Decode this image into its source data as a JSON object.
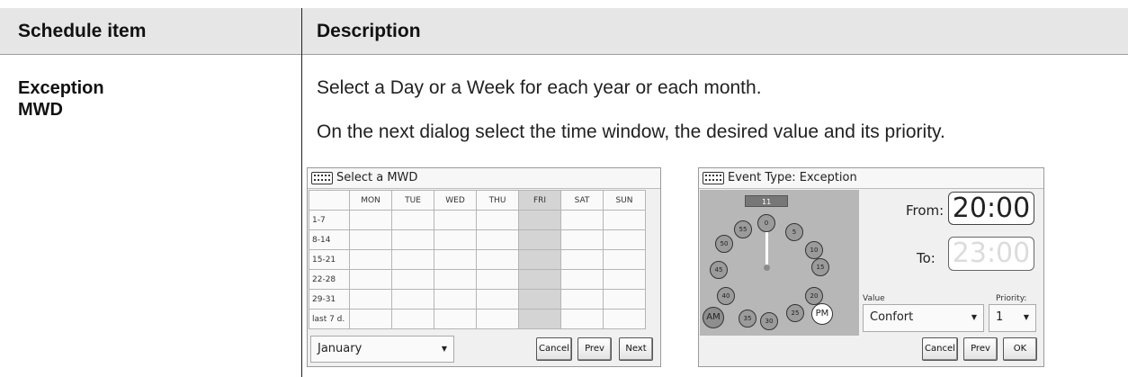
{
  "table": {
    "header_item": "Schedule item",
    "header_desc": "Description",
    "row_item_line1": "Exception",
    "row_item_line2": "MWD",
    "desc_line1": "Select a Day or a Week for each year or each month.",
    "desc_line2": "On the next dialog select the time window, the desired value and its priority."
  },
  "mwd_dialog": {
    "title": "Select a MWD",
    "days": [
      "MON",
      "TUE",
      "WED",
      "THU",
      "FRI",
      "SAT",
      "SUN"
    ],
    "rows": [
      "1-7",
      "8-14",
      "15-21",
      "22-28",
      "29-31",
      "last 7 d."
    ],
    "highlighted_day": "FRI",
    "month_value": "January",
    "cancel_label": "Cancel",
    "prev_label": "Prev",
    "next_label": "Next"
  },
  "event_dialog": {
    "title": "Event Type: Exception",
    "hour_readout": "11",
    "minute_marks": [
      "0",
      "5",
      "10",
      "15",
      "20",
      "25",
      "30",
      "35",
      "40",
      "45",
      "50",
      "55"
    ],
    "am_label": "AM",
    "pm_label": "PM",
    "from_label": "From:",
    "from_value": "20:00",
    "to_label": "To:",
    "to_value": "23:00",
    "value_label": "Value",
    "value_selected": "Confort",
    "priority_label": "Priority:",
    "priority_selected": "1",
    "cancel_label": "Cancel",
    "prev_label": "Prev",
    "ok_label": "OK"
  }
}
